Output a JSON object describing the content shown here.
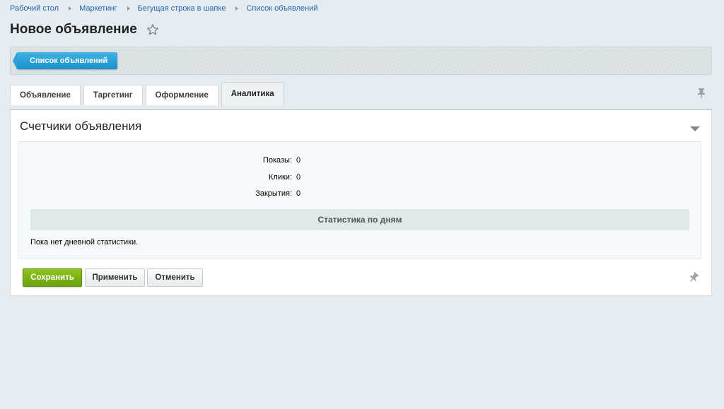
{
  "breadcrumb": [
    "Рабочий стол",
    "Маркетинг",
    "Бегущая строка в шапке",
    "Список объявлений"
  ],
  "page": {
    "title": "Новое объявление"
  },
  "toolbar": {
    "back_label": "Список объявлений"
  },
  "tabs": [
    "Объявление",
    "Таргетинг",
    "Оформление",
    "Аналитика"
  ],
  "active_tab": "Аналитика",
  "section": {
    "title": "Счетчики объявления",
    "fields": [
      {
        "label": "Показы:",
        "value": "0"
      },
      {
        "label": "Клики:",
        "value": "0"
      },
      {
        "label": "Закрытия:",
        "value": "0"
      }
    ],
    "stats_header": "Статистика по дням",
    "no_stats": "Пока нет дневной статистики."
  },
  "buttons": {
    "save": "Сохранить",
    "apply": "Применить",
    "cancel": "Отменить"
  },
  "colors": {
    "accent_blue": "#1b91cb",
    "save_green": "#6aa10d",
    "link": "#2067b0"
  },
  "icons": [
    "star-icon",
    "pin-icon",
    "chevron-down-icon"
  ]
}
